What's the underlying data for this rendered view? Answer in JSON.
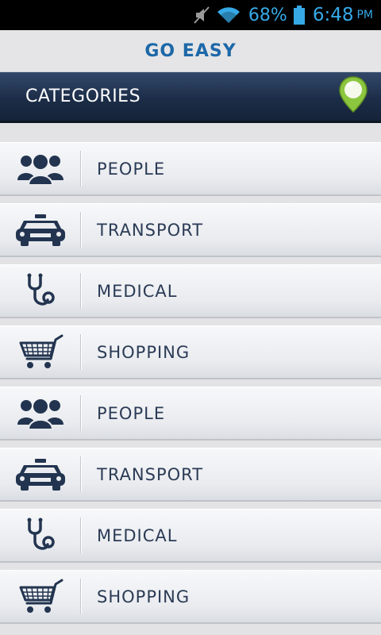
{
  "status_bar": {
    "battery_percent": "68%",
    "time": "6:48",
    "ampm": "PM",
    "accent": "#36a9e6"
  },
  "app": {
    "title": "GO EASY",
    "title_color": "#1d68a8"
  },
  "header": {
    "title": "CATEGORIES",
    "pin_color": "#8cc63f"
  },
  "categories": [
    {
      "label": "PEOPLE",
      "icon": "people-icon"
    },
    {
      "label": "TRANSPORT",
      "icon": "taxi-icon"
    },
    {
      "label": "MEDICAL",
      "icon": "stethoscope-icon"
    },
    {
      "label": "SHOPPING",
      "icon": "cart-icon"
    },
    {
      "label": "PEOPLE",
      "icon": "people-icon"
    },
    {
      "label": "TRANSPORT",
      "icon": "taxi-icon"
    },
    {
      "label": "MEDICAL",
      "icon": "stethoscope-icon"
    },
    {
      "label": "SHOPPING",
      "icon": "cart-icon"
    }
  ]
}
